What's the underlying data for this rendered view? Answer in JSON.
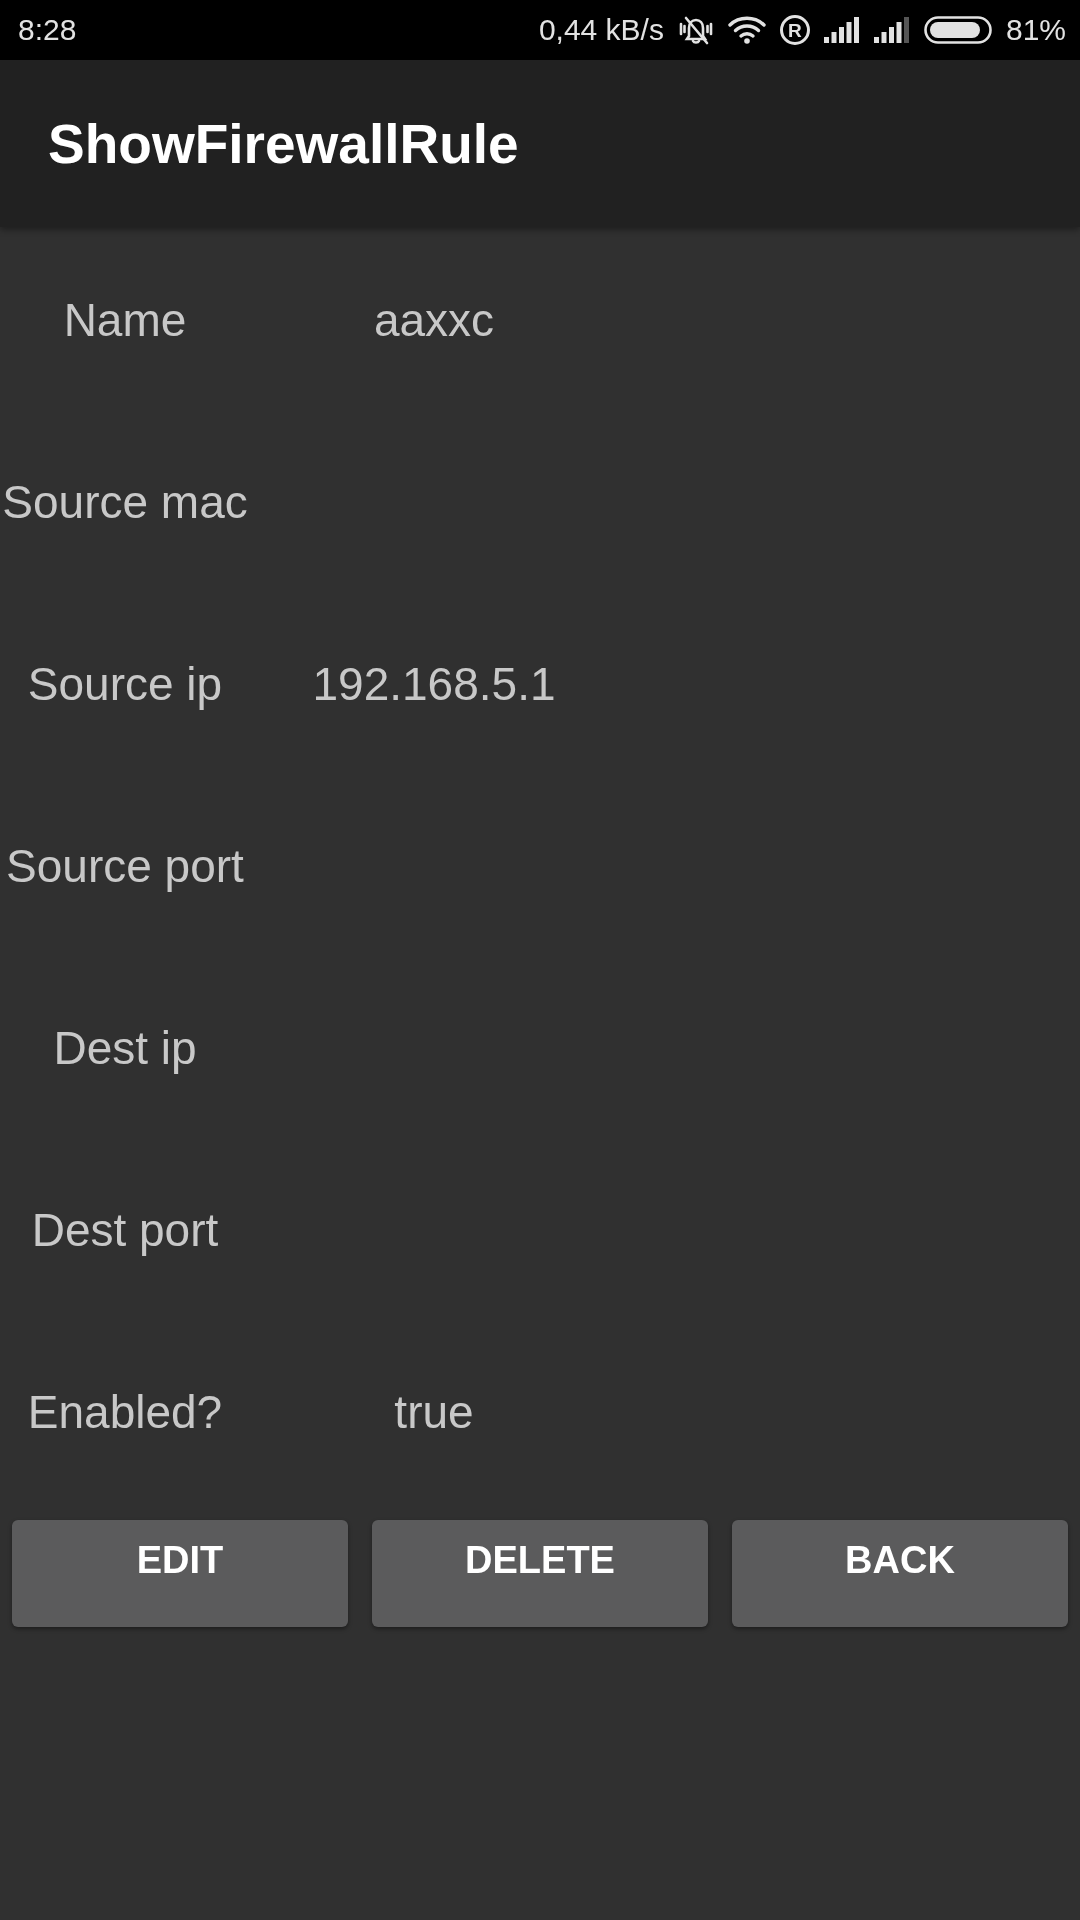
{
  "status_bar": {
    "time": "8:28",
    "network_speed": "0,44 kB/s",
    "roaming_glyph": "R",
    "battery_percent": "81%"
  },
  "app_bar": {
    "title": "ShowFirewallRule"
  },
  "fields": [
    {
      "label": "Name",
      "value": "aaxxc"
    },
    {
      "label": "Source mac"
    },
    {
      "label": "Source ip",
      "value": "192.168.5.1"
    },
    {
      "label": "Source port"
    },
    {
      "label": "Dest ip"
    },
    {
      "label": "Dest port"
    },
    {
      "label": "Enabled?",
      "value": "true"
    }
  ],
  "buttons": [
    "EDIT",
    "DELETE",
    "BACK"
  ]
}
